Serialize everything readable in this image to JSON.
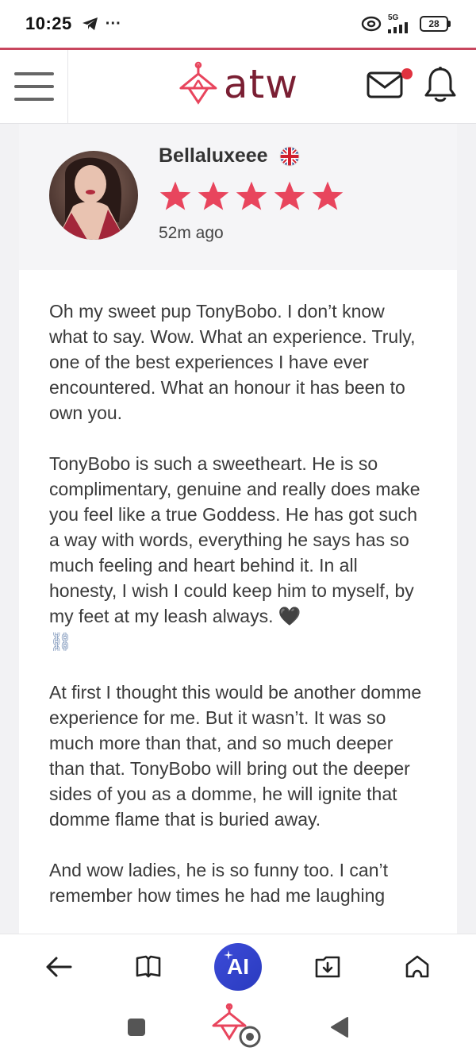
{
  "status_bar": {
    "time": "10:25",
    "dots": "···",
    "network": "5G",
    "battery": "28"
  },
  "header": {
    "logo_text": "atw",
    "accent_color": "#c8465e",
    "brand_color": "#7a1f33",
    "icons": [
      "menu-icon",
      "mail-icon",
      "bell-icon"
    ]
  },
  "review": {
    "author": "Bellaluxeee",
    "country_flag": "uk-flag-icon",
    "rating": 5,
    "rating_max": 5,
    "star_color": "#e8455d",
    "time_ago": "52m ago",
    "paragraphs": [
      "Oh my sweet pup TonyBobo. I don’t know what to say. Wow. What an experience. Truly, one of the best experiences I have ever encountered. What an honour it has been to own you.",
      "TonyBobo is such a sweetheart. He is so complimentary, genuine and really does make you feel like a true Goddess. He has got such a way with words, everything he says has so much feeling and heart behind it. In all honesty, I wish I could keep him to myself, by my feet at my leash always. 🖤",
      "At first I thought this would be another domme experience for me. But it wasn’t. It was so much more than that, and so much deeper than that. TonyBobo will bring out the deeper sides of you as a domme, he will ignite that domme flame that is buried away.",
      "And wow ladies, he is so funny too. I can’t remember how times he had me laughing"
    ],
    "chain_emoji": "⛓"
  },
  "browser_nav": {
    "ai_label": "AI",
    "icons": [
      "back-arrow-icon",
      "book-icon",
      "ai-assistant-icon",
      "download-icon",
      "home-icon"
    ]
  },
  "system_nav": {
    "icons": [
      "recents-square-icon",
      "app-logo-icon",
      "system-back-icon"
    ]
  }
}
